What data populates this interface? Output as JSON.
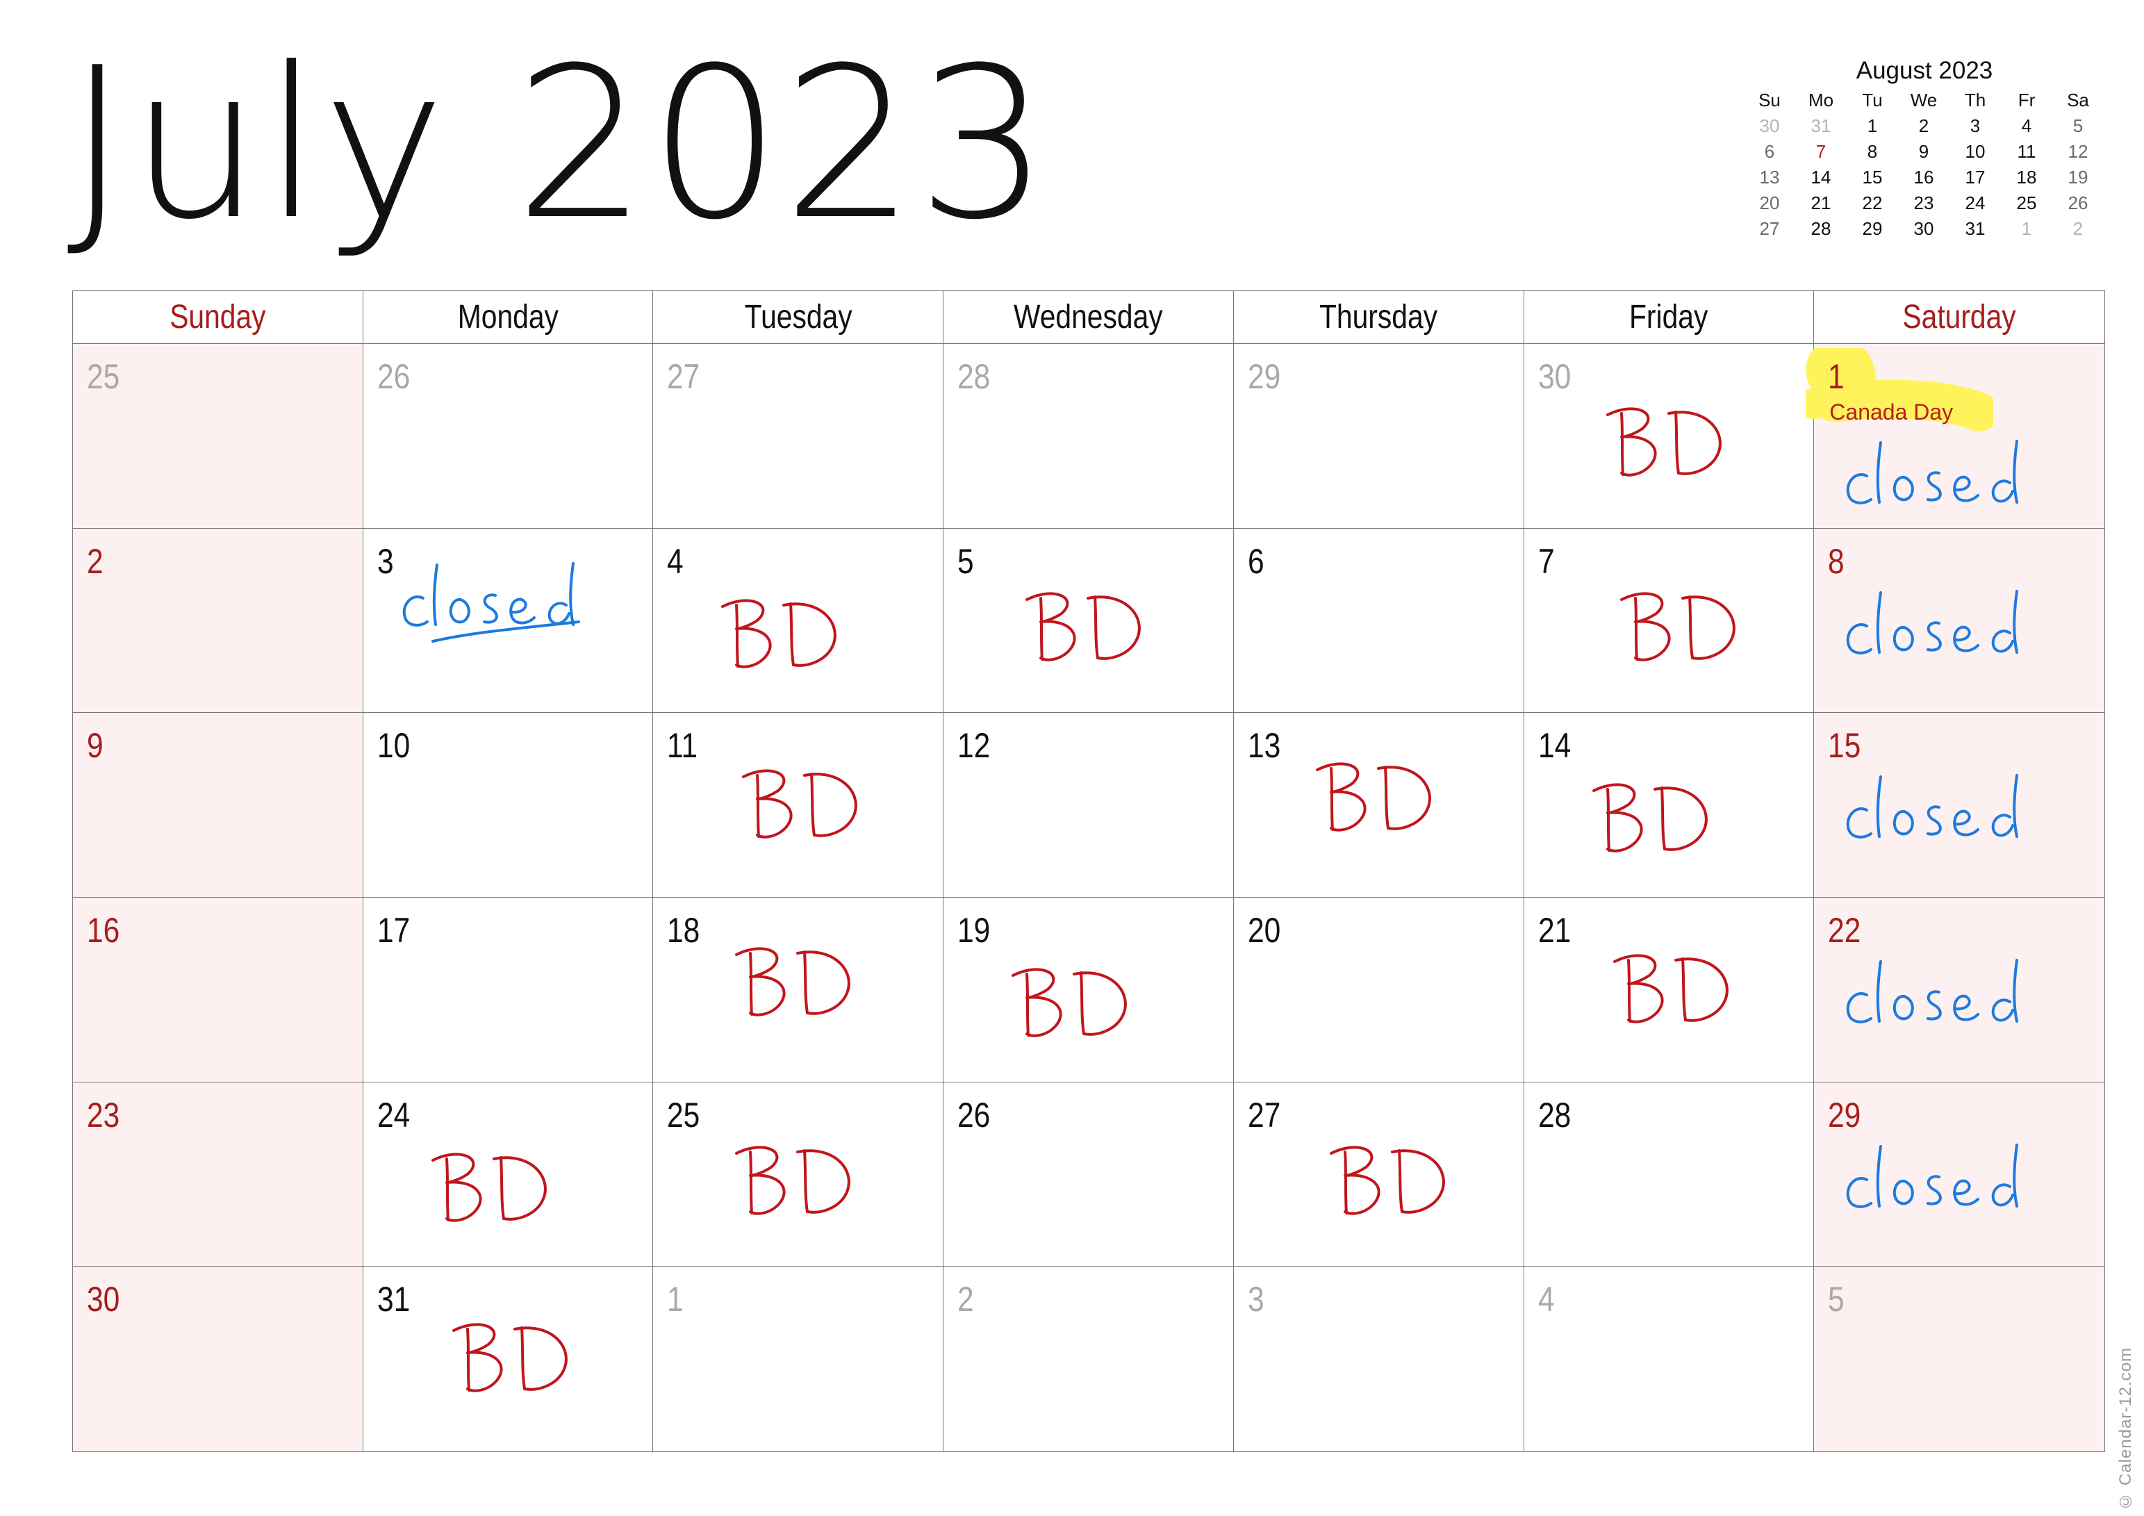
{
  "title": "July 2023",
  "mini_calendar": {
    "title": "August 2023",
    "weekdays": [
      "Su",
      "Mo",
      "Tu",
      "We",
      "Th",
      "Fr",
      "Sa"
    ],
    "weeks": [
      [
        "30",
        "31",
        "1",
        "2",
        "3",
        "4",
        "5"
      ],
      [
        "6",
        "7",
        "8",
        "9",
        "10",
        "11",
        "12"
      ],
      [
        "13",
        "14",
        "15",
        "16",
        "17",
        "18",
        "19"
      ],
      [
        "20",
        "21",
        "22",
        "23",
        "24",
        "25",
        "26"
      ],
      [
        "27",
        "28",
        "29",
        "30",
        "31",
        "1",
        "2"
      ]
    ],
    "holiday_day": "7"
  },
  "weekdays": [
    "Sunday",
    "Monday",
    "Tuesday",
    "Wednesday",
    "Thursday",
    "Friday",
    "Saturday"
  ],
  "colors": {
    "weekend_text": "#a51d1d",
    "weekend_bg": "#fdf0f0",
    "bd_ink": "#c0161c",
    "closed_ink": "#1d7ae0",
    "highlight": "#fff35c"
  },
  "cells": [
    {
      "day": "25",
      "other": true
    },
    {
      "day": "26",
      "other": true
    },
    {
      "day": "27",
      "other": true
    },
    {
      "day": "28",
      "other": true
    },
    {
      "day": "29",
      "other": true
    },
    {
      "day": "30",
      "other": true,
      "note": "bd"
    },
    {
      "day": "1",
      "holiday": "Canada Day",
      "note": "closed"
    },
    {
      "day": "2"
    },
    {
      "day": "3",
      "note": "closed"
    },
    {
      "day": "4",
      "note": "bd"
    },
    {
      "day": "5",
      "note": "bd"
    },
    {
      "day": "6"
    },
    {
      "day": "7",
      "note": "bd"
    },
    {
      "day": "8",
      "note": "closed"
    },
    {
      "day": "9"
    },
    {
      "day": "10"
    },
    {
      "day": "11",
      "note": "bd"
    },
    {
      "day": "12"
    },
    {
      "day": "13",
      "note": "bd"
    },
    {
      "day": "14",
      "note": "bd"
    },
    {
      "day": "15",
      "note": "closed"
    },
    {
      "day": "16"
    },
    {
      "day": "17"
    },
    {
      "day": "18",
      "note": "bd"
    },
    {
      "day": "19",
      "note": "bd"
    },
    {
      "day": "20"
    },
    {
      "day": "21",
      "note": "bd"
    },
    {
      "day": "22",
      "note": "closed"
    },
    {
      "day": "23"
    },
    {
      "day": "24",
      "note": "bd"
    },
    {
      "day": "25",
      "note": "bd"
    },
    {
      "day": "26"
    },
    {
      "day": "27",
      "note": "bd"
    },
    {
      "day": "28"
    },
    {
      "day": "29",
      "note": "closed"
    },
    {
      "day": "30"
    },
    {
      "day": "31",
      "note": "bd"
    },
    {
      "day": "1",
      "other": true
    },
    {
      "day": "2",
      "other": true
    },
    {
      "day": "3",
      "other": true
    },
    {
      "day": "4",
      "other": true
    },
    {
      "day": "5",
      "other": true
    }
  ],
  "notes": {
    "bd": "BD",
    "closed": "closed"
  },
  "watermark": "© Calendar-12.com"
}
